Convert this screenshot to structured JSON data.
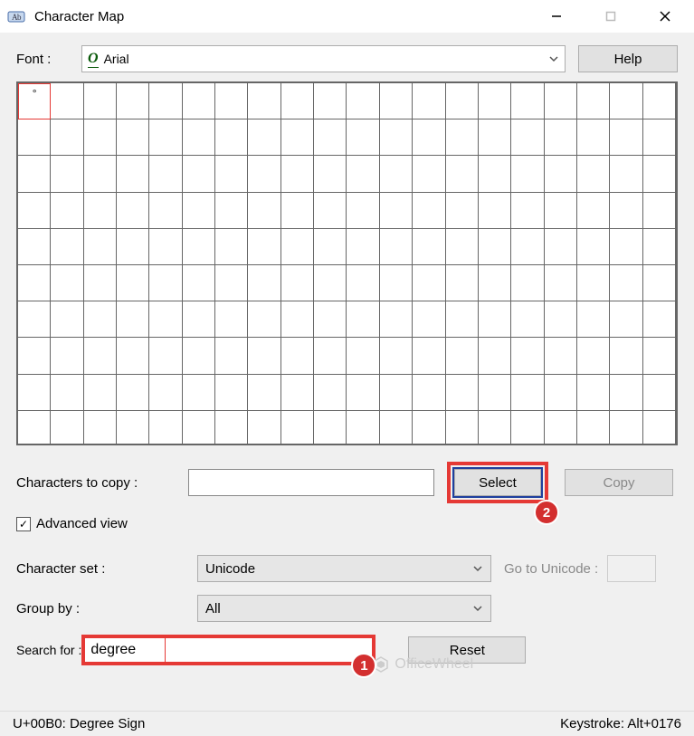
{
  "window": {
    "title": "Character Map"
  },
  "labels": {
    "font": "Font :",
    "characters_to_copy": "Characters to copy :",
    "advanced_view": "Advanced view",
    "character_set": "Character set :",
    "group_by": "Group by :",
    "search_for": "Search for :",
    "go_to_unicode": "Go to Unicode :"
  },
  "font": {
    "name": "Arial"
  },
  "buttons": {
    "help": "Help",
    "select": "Select",
    "copy": "Copy",
    "reset": "Reset"
  },
  "grid": {
    "cols": 20,
    "rows": 10,
    "selected_glyph": "°"
  },
  "copy_field": {
    "value": ""
  },
  "character_set": {
    "value": "Unicode"
  },
  "group_by": {
    "value": "All"
  },
  "go_to_unicode": {
    "value": ""
  },
  "search": {
    "value": "degree"
  },
  "status": {
    "left": "U+00B0: Degree Sign",
    "right": "Keystroke: Alt+0176"
  },
  "annotations": {
    "badge1": "1",
    "badge2": "2"
  },
  "watermark": {
    "text": "OfficeWheel"
  }
}
